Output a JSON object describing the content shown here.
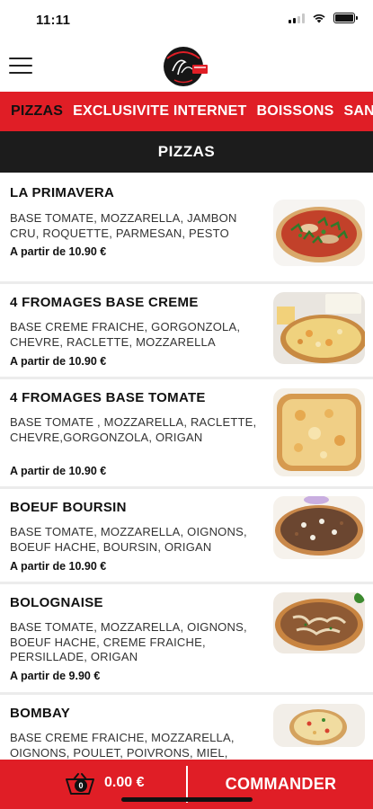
{
  "status_bar": {
    "time": "11:11"
  },
  "header": {
    "logo_icon": "pizza-logo",
    "menu_icon": "hamburger-menu-icon"
  },
  "categories": [
    {
      "label": "PIZZAS",
      "active": true
    },
    {
      "label": "EXCLUSIVITE INTERNET",
      "active": false
    },
    {
      "label": "BOISSONS",
      "active": false
    },
    {
      "label": "SAN",
      "active": false
    }
  ],
  "section": {
    "title": "PIZZAS"
  },
  "products": [
    {
      "name": "LA PRIMAVERA",
      "description": "BASE TOMATE, MOZZARELLA, JAMBON CRU, ROQUETTE, PARMESAN, PESTO",
      "price": "A partir de 10.90 €"
    },
    {
      "name": "4 FROMAGES BASE CREME",
      "description": "BASE CREME FRAICHE, GORGONZOLA, CHEVRE, RACLETTE, MOZZARELLA",
      "price": "A partir de 10.90 €"
    },
    {
      "name": "4 FROMAGES BASE TOMATE",
      "description": "BASE TOMATE , MOZZARELLA, RACLETTE, CHEVRE,GORGONZOLA, ORIGAN",
      "price": "A partir de 10.90 €"
    },
    {
      "name": "BOEUF BOURSIN",
      "description": "BASE TOMATE, MOZZARELLA, OIGNONS, BOEUF HACHE, BOURSIN, ORIGAN",
      "price": "A partir de 10.90 €"
    },
    {
      "name": "BOLOGNAISE",
      "description": "BASE TOMATE, MOZZARELLA, OIGNONS, BOEUF HACHE, CREME FRAICHE, PERSILLADE, ORIGAN",
      "price": "A partir de 9.90 €"
    },
    {
      "name": "BOMBAY",
      "description": "BASE CREME FRAICHE, MOZZARELLA, OIGNONS, POULET, POIVRONS, MIEL,",
      "price": ""
    }
  ],
  "cart": {
    "count": "0",
    "total": "0.00 €",
    "icon": "basket-icon"
  },
  "order_button": {
    "label": "COMMANDER"
  },
  "colors": {
    "brand_red": "#e01e26",
    "section_dark": "#1c1c1c"
  }
}
